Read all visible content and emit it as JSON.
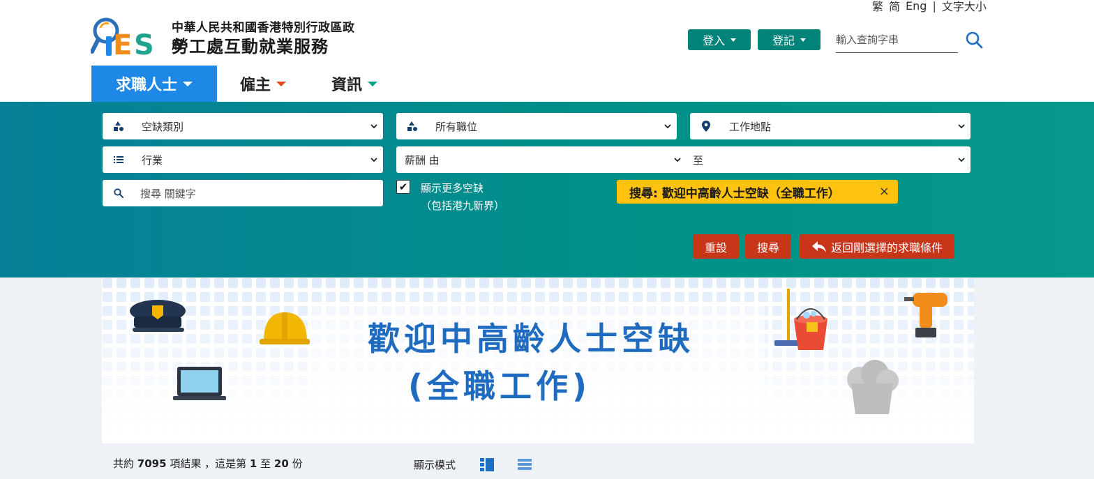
{
  "header": {
    "lang": {
      "trad": "繁",
      "simp": "简",
      "eng": "Eng",
      "separator": "|",
      "font_size": "文字大小"
    },
    "logo": {
      "mark_text": "iES",
      "line1": "中華人民共和國香港特別行政區政府",
      "line2": "勞工處互動就業服務"
    },
    "login_label": "登入",
    "register_label": "登記",
    "search_placeholder": "輸入查詢字串",
    "colors": {
      "button_bg": "#00847a",
      "nav_active_bg": "#1d88e6"
    }
  },
  "nav": {
    "items": [
      {
        "label": "求職人士",
        "caret_color": "#ffffff",
        "active": true
      },
      {
        "label": "僱主",
        "caret_color": "#e64a19",
        "active": false
      },
      {
        "label": "資訊",
        "caret_color": "#00a08a",
        "active": false
      }
    ]
  },
  "search": {
    "vacancy_type": "空缺類別",
    "all_positions": "所有職位",
    "work_location": "工作地點",
    "industry": "行業",
    "salary_from": "薪酬 由",
    "salary_to": "至",
    "keyword_placeholder": "搜尋 關鍵字",
    "more_vacancies_line1": "顯示更多空缺",
    "more_vacancies_line2": "（包括港九新界）",
    "more_vacancies_checked": true,
    "active_tag": "搜尋: 歡迎中高齡人士空缺（全職工作）",
    "tag_close": "×",
    "reset_label": "重設",
    "search_label": "搜尋",
    "back_label": "返回剛選擇的求職條件",
    "colors": {
      "tag_bg": "#ffc20e",
      "action_button_bg": "#c8361a"
    }
  },
  "banner": {
    "title_line1": "歡迎中高齡人士空缺",
    "title_line2": "(全職工作)"
  },
  "results": {
    "prefix": "共約",
    "total": "7095",
    "middle": "項結果 ，這是第",
    "from": "1",
    "to_word": "至",
    "to": "20",
    "suffix": "份",
    "view_mode_label": "顯示模式"
  }
}
